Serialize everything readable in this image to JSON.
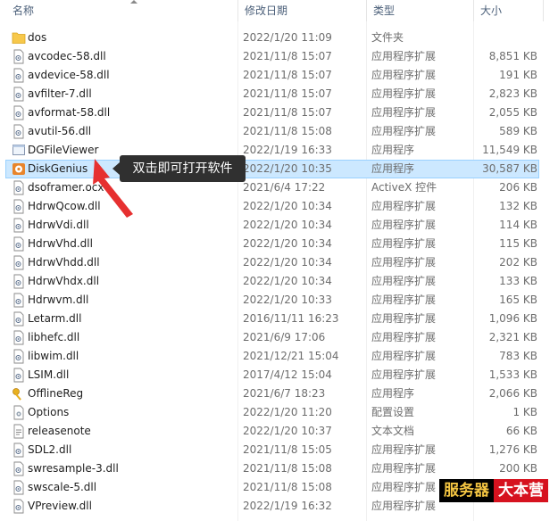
{
  "columns": {
    "name": "名称",
    "date": "修改日期",
    "type": "类型",
    "size": "大小"
  },
  "files": [
    {
      "name": "dos",
      "date": "2022/1/20 11:09",
      "type": "文件夹",
      "size": "",
      "icon": "folder"
    },
    {
      "name": "avcodec-58.dll",
      "date": "2021/11/8 15:07",
      "type": "应用程序扩展",
      "size": "8,851 KB",
      "icon": "dll"
    },
    {
      "name": "avdevice-58.dll",
      "date": "2021/11/8 15:07",
      "type": "应用程序扩展",
      "size": "191 KB",
      "icon": "dll"
    },
    {
      "name": "avfilter-7.dll",
      "date": "2021/11/8 15:07",
      "type": "应用程序扩展",
      "size": "2,823 KB",
      "icon": "dll"
    },
    {
      "name": "avformat-58.dll",
      "date": "2021/11/8 15:07",
      "type": "应用程序扩展",
      "size": "2,055 KB",
      "icon": "dll"
    },
    {
      "name": "avutil-56.dll",
      "date": "2021/11/8 15:08",
      "type": "应用程序扩展",
      "size": "589 KB",
      "icon": "dll"
    },
    {
      "name": "DGFileViewer",
      "date": "2022/1/19 16:33",
      "type": "应用程序",
      "size": "11,549 KB",
      "icon": "app"
    },
    {
      "name": "DiskGenius",
      "date": "2022/1/20 10:35",
      "type": "应用程序",
      "size": "30,587 KB",
      "icon": "diskgenius"
    },
    {
      "name": "dsoframer.ocx",
      "date": "2021/6/4 17:22",
      "type": "ActiveX 控件",
      "size": "206 KB",
      "icon": "dll"
    },
    {
      "name": "HdrwQcow.dll",
      "date": "2022/1/20 10:34",
      "type": "应用程序扩展",
      "size": "132 KB",
      "icon": "dll"
    },
    {
      "name": "HdrwVdi.dll",
      "date": "2022/1/20 10:34",
      "type": "应用程序扩展",
      "size": "114 KB",
      "icon": "dll"
    },
    {
      "name": "HdrwVhd.dll",
      "date": "2022/1/20 10:34",
      "type": "应用程序扩展",
      "size": "115 KB",
      "icon": "dll"
    },
    {
      "name": "HdrwVhdd.dll",
      "date": "2022/1/20 10:34",
      "type": "应用程序扩展",
      "size": "202 KB",
      "icon": "dll"
    },
    {
      "name": "HdrwVhdx.dll",
      "date": "2022/1/20 10:34",
      "type": "应用程序扩展",
      "size": "133 KB",
      "icon": "dll"
    },
    {
      "name": "Hdrwvm.dll",
      "date": "2022/1/20 10:33",
      "type": "应用程序扩展",
      "size": "165 KB",
      "icon": "dll"
    },
    {
      "name": "Letarm.dll",
      "date": "2016/11/11 16:23",
      "type": "应用程序扩展",
      "size": "1,096 KB",
      "icon": "dll"
    },
    {
      "name": "libhefc.dll",
      "date": "2021/6/9 17:06",
      "type": "应用程序扩展",
      "size": "2,321 KB",
      "icon": "dll"
    },
    {
      "name": "libwim.dll",
      "date": "2021/12/21 15:04",
      "type": "应用程序扩展",
      "size": "783 KB",
      "icon": "dll"
    },
    {
      "name": "LSIM.dll",
      "date": "2017/4/12 15:04",
      "type": "应用程序扩展",
      "size": "1,533 KB",
      "icon": "dll"
    },
    {
      "name": "OfflineReg",
      "date": "2021/6/7 18:23",
      "type": "应用程序",
      "size": "2,066 KB",
      "icon": "key"
    },
    {
      "name": "Options",
      "date": "2022/1/20 11:20",
      "type": "配置设置",
      "size": "1 KB",
      "icon": "settings"
    },
    {
      "name": "releasenote",
      "date": "2022/1/20 10:37",
      "type": "文本文档",
      "size": "66 KB",
      "icon": "text"
    },
    {
      "name": "SDL2.dll",
      "date": "2021/11/8 15:05",
      "type": "应用程序扩展",
      "size": "1,276 KB",
      "icon": "dll"
    },
    {
      "name": "swresample-3.dll",
      "date": "2021/11/8 15:08",
      "type": "应用程序扩展",
      "size": "200 KB",
      "icon": "dll"
    },
    {
      "name": "swscale-5.dll",
      "date": "2021/11/8 15:08",
      "type": "应用程序扩展",
      "size": "",
      "icon": "dll"
    },
    {
      "name": "VPreview.dll",
      "date": "2022/1/19 16:32",
      "type": "应用程序扩展",
      "size": "",
      "icon": "dll"
    }
  ],
  "selected_index": 7,
  "callout": {
    "text": "双击即可打开软件"
  },
  "watermark": {
    "part1": "服务器",
    "part2": "大本营"
  },
  "colors": {
    "selection": "#cce8ff",
    "selection_border": "#99d1ff",
    "arrow": "#e63030",
    "folder": "#f7c84b"
  }
}
